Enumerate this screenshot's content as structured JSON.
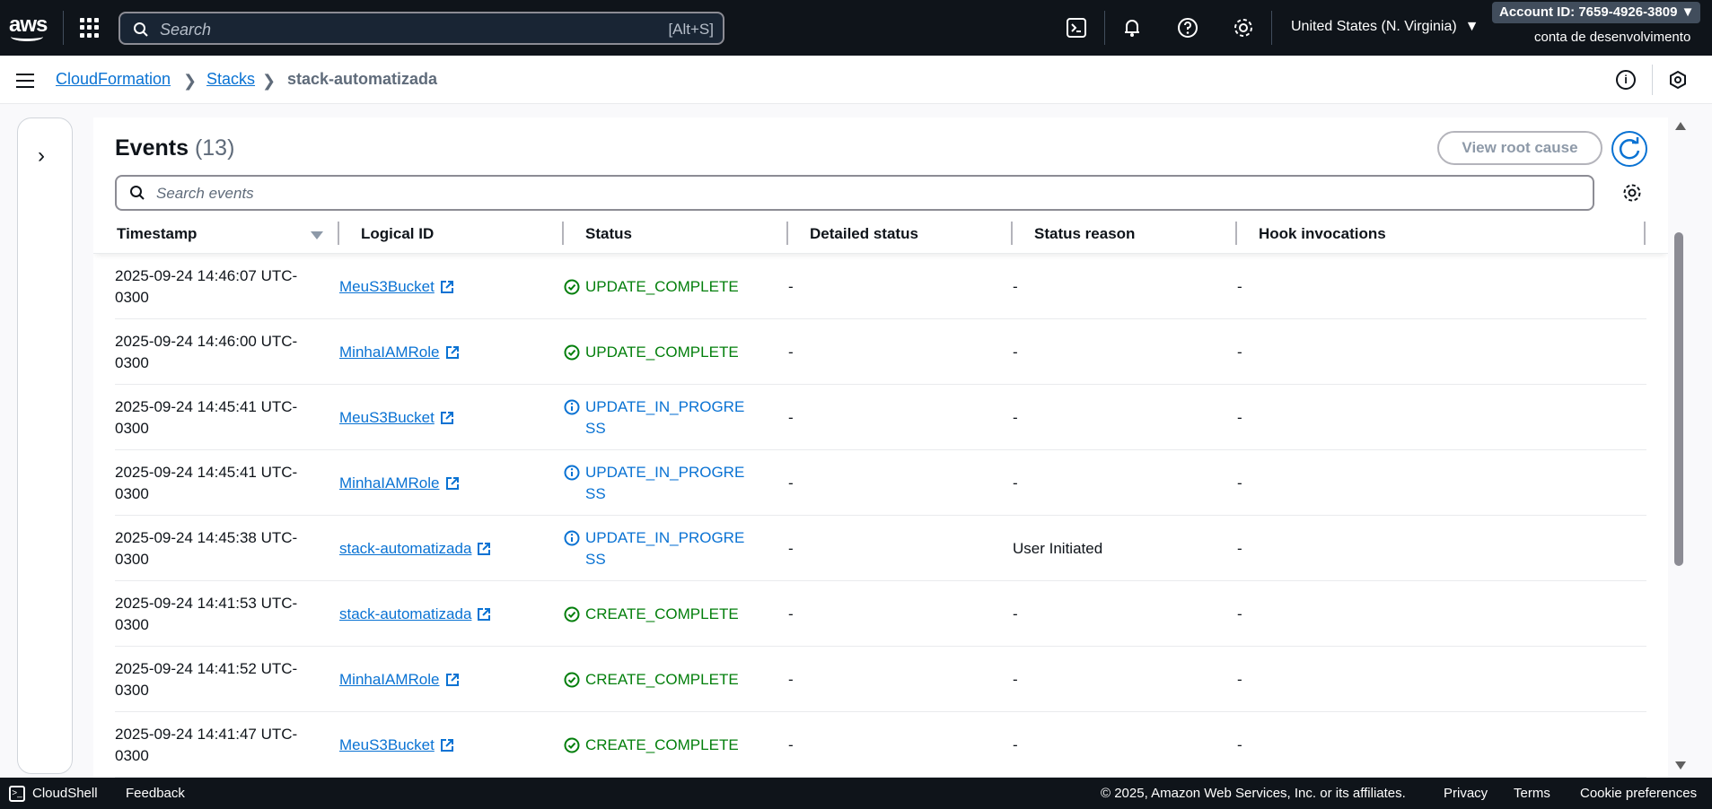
{
  "topnav": {
    "logo_text": "aws",
    "search_placeholder": "Search",
    "search_shortcut": "[Alt+S]",
    "region": "United States (N. Virginia)",
    "account_id": "Account ID: 7659-4926-3809",
    "account_name": "conta de desenvolvimento"
  },
  "breadcrumb": {
    "items": [
      "CloudFormation",
      "Stacks",
      "stack-automatizada"
    ]
  },
  "events": {
    "title": "Events",
    "count": "(13)",
    "view_root_cause": "View root cause",
    "search_placeholder": "Search events",
    "columns": [
      "Timestamp",
      "Logical ID",
      "Status",
      "Detailed status",
      "Status reason",
      "Hook invocations"
    ],
    "rows": [
      {
        "ts1": "2025-09-24 14:46:07 UTC-",
        "ts2": "0300",
        "logical_id": "MeuS3Bucket",
        "status1": "UPDATE_COMPLETE",
        "status2": "",
        "kind": "ok",
        "detailed": "-",
        "reason": "-",
        "hook": "-"
      },
      {
        "ts1": "2025-09-24 14:46:00 UTC-",
        "ts2": "0300",
        "logical_id": "MinhaIAMRole",
        "status1": "UPDATE_COMPLETE",
        "status2": "",
        "kind": "ok",
        "detailed": "-",
        "reason": "-",
        "hook": "-"
      },
      {
        "ts1": "2025-09-24 14:45:41 UTC-",
        "ts2": "0300",
        "logical_id": "MeuS3Bucket",
        "status1": "UPDATE_IN_PROGRE",
        "status2": "SS",
        "kind": "prog",
        "detailed": "-",
        "reason": "-",
        "hook": "-"
      },
      {
        "ts1": "2025-09-24 14:45:41 UTC-",
        "ts2": "0300",
        "logical_id": "MinhaIAMRole",
        "status1": "UPDATE_IN_PROGRE",
        "status2": "SS",
        "kind": "prog",
        "detailed": "-",
        "reason": "-",
        "hook": "-"
      },
      {
        "ts1": "2025-09-24 14:45:38 UTC-",
        "ts2": "0300",
        "logical_id": "stack-automatizada",
        "status1": "UPDATE_IN_PROGRE",
        "status2": "SS",
        "kind": "prog",
        "detailed": "-",
        "reason": "User Initiated",
        "hook": "-"
      },
      {
        "ts1": "2025-09-24 14:41:53 UTC-",
        "ts2": "0300",
        "logical_id": "stack-automatizada",
        "status1": "CREATE_COMPLETE",
        "status2": "",
        "kind": "ok",
        "detailed": "-",
        "reason": "-",
        "hook": "-"
      },
      {
        "ts1": "2025-09-24 14:41:52 UTC-",
        "ts2": "0300",
        "logical_id": "MinhaIAMRole",
        "status1": "CREATE_COMPLETE",
        "status2": "",
        "kind": "ok",
        "detailed": "-",
        "reason": "-",
        "hook": "-"
      },
      {
        "ts1": "2025-09-24 14:41:47 UTC-",
        "ts2": "0300",
        "logical_id": "MeuS3Bucket",
        "status1": "CREATE_COMPLETE",
        "status2": "",
        "kind": "ok",
        "detailed": "-",
        "reason": "-",
        "hook": "-"
      }
    ]
  },
  "footer": {
    "cloudshell": "CloudShell",
    "feedback": "Feedback",
    "copyright": "© 2025, Amazon Web Services, Inc. or its affiliates.",
    "privacy": "Privacy",
    "terms": "Terms",
    "cookies": "Cookie preferences"
  },
  "colors": {
    "nav_bg": "#0f141a",
    "link": "#0972d3",
    "success": "#037f0c"
  }
}
